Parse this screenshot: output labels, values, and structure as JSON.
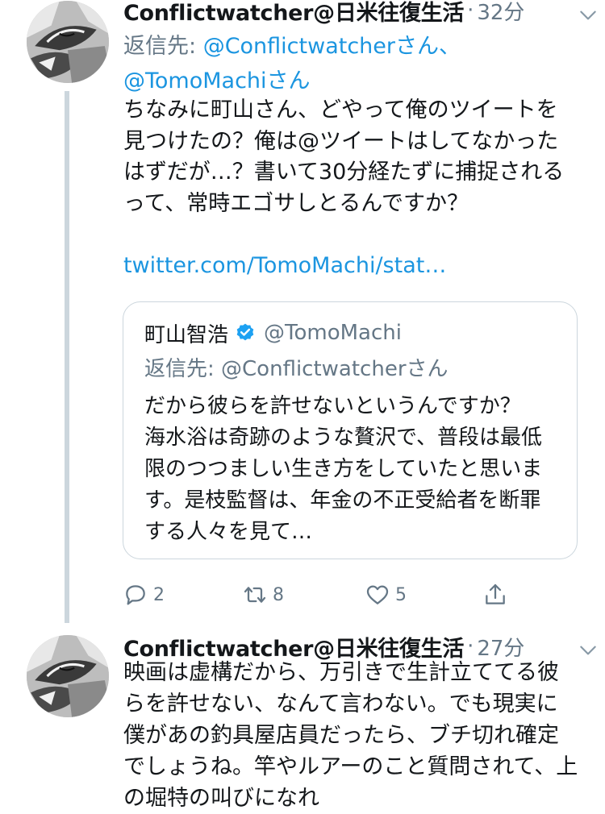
{
  "tweets": [
    {
      "name": "Conflictwatcher@日米往復生活",
      "separator": "·",
      "time": "32分",
      "reply_prefix": "返信先: ",
      "reply_mentions": "@Conflictwatcherさん、@TomoMachiさん",
      "text": "ちなみに町山さん、どやって俺のツイートを見つけたの？俺は@ツイートはしてなかったはずだが…？書いて30分経たずに捕捉されるって、常時エゴサしとるんですか？",
      "link": "twitter.com/TomoMachi/stat…",
      "quote": {
        "name": "町山智浩",
        "handle": "@TomoMachi",
        "reply": "返信先: @Conflictwatcherさん",
        "text": "だから彼らを許せないというんですか？　海水浴は奇跡のような贅沢で、普段は最低限のつつましい生き方をしていたと思います。是枝監督は、年金の不正受給者を断罪する人々を見て…"
      },
      "actions": {
        "reply_count": "2",
        "retweet_count": "8",
        "like_count": "5"
      }
    },
    {
      "name": "Conflictwatcher@日米往復生活",
      "separator": "·",
      "time": "27分",
      "text": "映画は虚構だから、万引きで生計立ててる彼らを許せない、なんて言わない。でも現実に僕があの釣具屋店員だったら、ブチ切れ確定でしょうね。竿やルアーのこと質問されて、上の堀特の叫びになれ"
    }
  ],
  "icons": {
    "reply": "reply-icon",
    "retweet": "retweet-icon",
    "like": "heart-icon",
    "share": "share-icon",
    "menu": "chevron-down-icon",
    "verified": "verified-badge-icon"
  },
  "colors": {
    "link": "#1b95e0",
    "secondary": "#657786",
    "border": "#ccd6dd",
    "verified": "#1da1f2"
  }
}
